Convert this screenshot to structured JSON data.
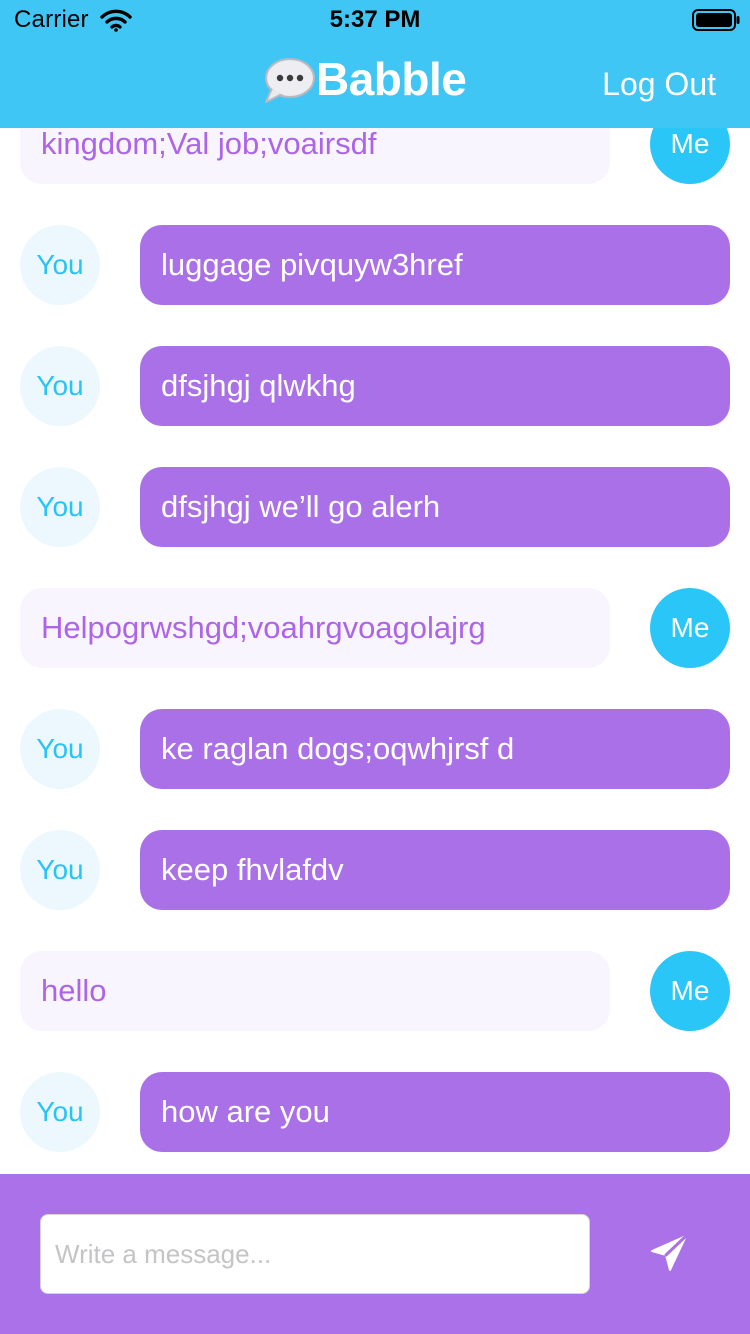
{
  "status_bar": {
    "carrier": "Carrier",
    "time": "5:37 PM"
  },
  "nav": {
    "title": "Babble",
    "logout_label": "Log Out"
  },
  "colors": {
    "header": "#40c6f4",
    "you_bubble": "#aa70e8",
    "me_bubble": "#f8f5fe",
    "me_text": "#ad65e8",
    "me_avatar": "#2ac6f8",
    "you_avatar": "#ecf8fe",
    "composer": "#aa71e8"
  },
  "icons": {
    "logo": "speech-bubble-icon",
    "send": "paper-plane-icon",
    "wifi": "wifi-icon",
    "battery": "battery-icon"
  },
  "messages": [
    {
      "sender": "me",
      "avatar": "Me",
      "text": "kingdom;Val job;voairsdf"
    },
    {
      "sender": "you",
      "avatar": "You",
      "text": "luggage pivquyw3href"
    },
    {
      "sender": "you",
      "avatar": "You",
      "text": "dfsjhgj qlwkhg"
    },
    {
      "sender": "you",
      "avatar": "You",
      "text": "dfsjhgj we’ll go alerh"
    },
    {
      "sender": "me",
      "avatar": "Me",
      "text": "Helpogrwshgd;voahrgvoagolajrg"
    },
    {
      "sender": "you",
      "avatar": "You",
      "text": "ke raglan dogs;oqwhjrsf d"
    },
    {
      "sender": "you",
      "avatar": "You",
      "text": "keep fhvlafdv"
    },
    {
      "sender": "me",
      "avatar": "Me",
      "text": "hello"
    },
    {
      "sender": "you",
      "avatar": "You",
      "text": "how are you"
    }
  ],
  "composer": {
    "placeholder": "Write a message...",
    "value": ""
  }
}
